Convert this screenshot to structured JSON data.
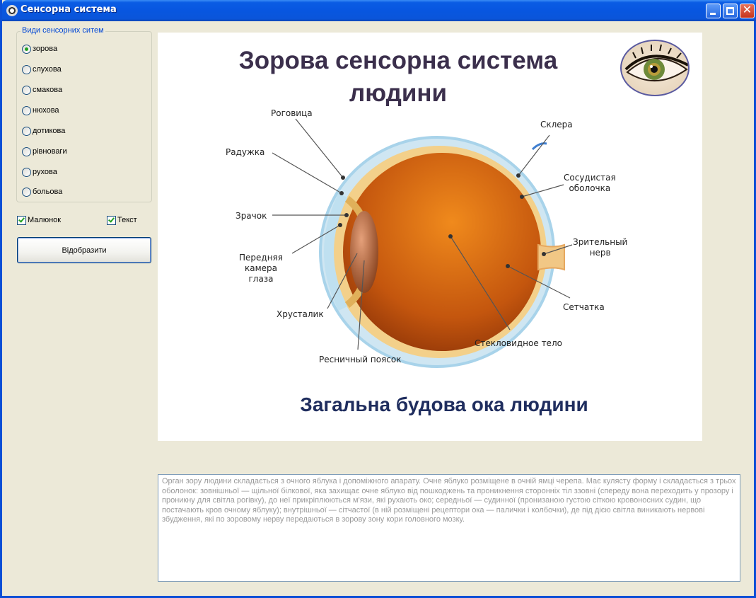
{
  "window": {
    "title": "Сенсорна система",
    "icon": "app-icon"
  },
  "group": {
    "label": "Види сенсорних ситем",
    "options": [
      {
        "label": "зорова",
        "checked": true
      },
      {
        "label": "слухова",
        "checked": false
      },
      {
        "label": "смакова",
        "checked": false
      },
      {
        "label": "нюхова",
        "checked": false
      },
      {
        "label": "дотикова",
        "checked": false
      },
      {
        "label": "рівноваги",
        "checked": false
      },
      {
        "label": "рухова",
        "checked": false
      },
      {
        "label": "больова",
        "checked": false
      }
    ]
  },
  "checkboxes": {
    "picture_label": "Малюнок",
    "picture_checked": true,
    "text_label": "Текст",
    "text_checked": true
  },
  "show_button": "Відобразити",
  "picture": {
    "title_line1": "Зорова сенсорна система",
    "title_line2": "людини",
    "caption": "Загальна будова ока людини",
    "labels": {
      "cornea": "Роговица",
      "iris": "Радужка",
      "pupil": "Зрачок",
      "anterior_chamber": "Передняя\nкамера\nглаза",
      "lens": "Хрусталик",
      "ciliary": "Ресничный поясок",
      "vitreous": "Стекловидное тело",
      "retina": "Сетчатка",
      "optic_nerve": "Зрительный\nнерв",
      "choroid": "Сосудистая\nоболочка",
      "sclera": "Склера"
    }
  },
  "description": "Орган зору людини складається з очного яблука і допоміжного апарату. Очне яблуко розміщене в очній ямці черепа. Має кулясту форму і складається з трьох оболонок: зовнішньої — щільної білкової, яка захищає очне яблуко від пошкоджень та проникнення сторонніх тіл ззовні (спереду вона переходить у прозору і проникну для світла рогівку), до неї прикріплюються м'язи, які рухають око; середньої — судинної (пронизаною густою сіткою кровоносних судин, що постачають кров очному яблуку); внутрішньої — сітчастої (в ній розміщені рецептори ока — палички і колбочки), де під дією світла виникають нервові збудження, які по зоровому нерву передаються в зорову зону кори головного мозку.",
  "colors": {
    "titlebar": "#0a5ce4",
    "window_bg": "#ece9d8",
    "group_label": "#0046d5",
    "check_accent": "#21a121",
    "eye_orange": "#d9731a"
  }
}
